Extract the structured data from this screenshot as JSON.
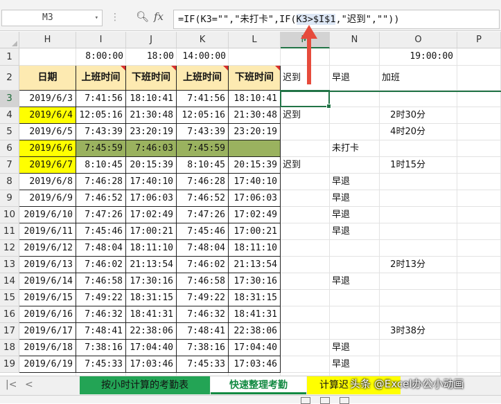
{
  "formula_bar": {
    "name_box": "M3",
    "name_box_dropdown": "▾",
    "separator": "⋮",
    "fx_label": "fx",
    "formula_prefix": "=IF(K3=\"\",\"未打卡\",IF(",
    "formula_highlight": "K3>$I$1",
    "formula_suffix": ",\"迟到\",\"\"))"
  },
  "columns": [
    "H",
    "I",
    "J",
    "K",
    "L",
    "M",
    "N",
    "O",
    "P"
  ],
  "selected_column": "M",
  "selected_row": "3",
  "row_numbers": [
    "1",
    "2",
    "3",
    "4",
    "5",
    "6",
    "7",
    "8",
    "9",
    "10",
    "11",
    "12",
    "13",
    "14",
    "15",
    "16",
    "17",
    "18",
    "19"
  ],
  "row1": {
    "I": "8:00:00",
    "J": "18:00",
    "K": "14:00:00",
    "O": "19:00:00"
  },
  "headers": {
    "H": "日期",
    "I": "上班时间",
    "J": "下班时间",
    "K": "上班时间",
    "L": "下班时间",
    "M": "迟到",
    "N": "早退",
    "O": "加班"
  },
  "rows": [
    {
      "date": "2019/6/3",
      "i": "7:41:56",
      "j": "18:10:41",
      "k": "7:41:56",
      "l": "18:10:41",
      "m": "",
      "n": "",
      "o": ""
    },
    {
      "date": "2019/6/4",
      "i": "12:05:16",
      "j": "21:30:48",
      "k": "12:05:16",
      "l": "21:30:48",
      "m": "迟到",
      "n": "",
      "o": "2时30分"
    },
    {
      "date": "2019/6/5",
      "i": "7:43:39",
      "j": "23:20:19",
      "k": "7:43:39",
      "l": "23:20:19",
      "m": "",
      "n": "",
      "o": "4时20分"
    },
    {
      "date": "2019/6/6",
      "i": "7:45:59",
      "j": "7:46:03",
      "k": "7:45:59",
      "l": "",
      "m": "",
      "n": "未打卡",
      "o": ""
    },
    {
      "date": "2019/6/7",
      "i": "8:10:45",
      "j": "20:15:39",
      "k": "8:10:45",
      "l": "20:15:39",
      "m": "迟到",
      "n": "",
      "o": "1时15分"
    },
    {
      "date": "2019/6/8",
      "i": "7:46:28",
      "j": "17:40:10",
      "k": "7:46:28",
      "l": "17:40:10",
      "m": "",
      "n": "早退",
      "o": ""
    },
    {
      "date": "2019/6/9",
      "i": "7:46:52",
      "j": "17:06:03",
      "k": "7:46:52",
      "l": "17:06:03",
      "m": "",
      "n": "早退",
      "o": ""
    },
    {
      "date": "2019/6/10",
      "i": "7:47:26",
      "j": "17:02:49",
      "k": "7:47:26",
      "l": "17:02:49",
      "m": "",
      "n": "早退",
      "o": ""
    },
    {
      "date": "2019/6/11",
      "i": "7:45:46",
      "j": "17:00:21",
      "k": "7:45:46",
      "l": "17:00:21",
      "m": "",
      "n": "早退",
      "o": ""
    },
    {
      "date": "2019/6/12",
      "i": "7:48:04",
      "j": "18:11:10",
      "k": "7:48:04",
      "l": "18:11:10",
      "m": "",
      "n": "",
      "o": ""
    },
    {
      "date": "2019/6/13",
      "i": "7:46:02",
      "j": "21:13:54",
      "k": "7:46:02",
      "l": "21:13:54",
      "m": "",
      "n": "",
      "o": "2时13分"
    },
    {
      "date": "2019/6/14",
      "i": "7:46:58",
      "j": "17:30:16",
      "k": "7:46:58",
      "l": "17:30:16",
      "m": "",
      "n": "早退",
      "o": ""
    },
    {
      "date": "2019/6/15",
      "i": "7:49:22",
      "j": "18:31:15",
      "k": "7:49:22",
      "l": "18:31:15",
      "m": "",
      "n": "",
      "o": ""
    },
    {
      "date": "2019/6/16",
      "i": "7:46:32",
      "j": "18:41:31",
      "k": "7:46:32",
      "l": "18:41:31",
      "m": "",
      "n": "",
      "o": ""
    },
    {
      "date": "2019/6/17",
      "i": "7:48:41",
      "j": "22:38:06",
      "k": "7:48:41",
      "l": "22:38:06",
      "m": "",
      "n": "",
      "o": "3时38分"
    },
    {
      "date": "2019/6/18",
      "i": "7:38:16",
      "j": "17:04:40",
      "k": "7:38:16",
      "l": "17:04:40",
      "m": "",
      "n": "早退",
      "o": ""
    },
    {
      "date": "2019/6/19",
      "i": "7:45:33",
      "j": "17:03:46",
      "k": "7:45:33",
      "l": "17:03:46",
      "m": "",
      "n": "早退",
      "o": ""
    }
  ],
  "row_fills": {
    "yellow_date_rows": [
      1,
      3,
      4
    ],
    "green_rows": [
      3
    ],
    "yellow": "#ffff00",
    "green": "#9ab25f",
    "header_fill": "#fdeab1",
    "comment_marker": "#d9302c"
  },
  "sheet_tabs": {
    "prev_first": "|<",
    "prev": "<",
    "tabs": [
      "按小时计算的考勤表",
      "快速整理考勤",
      "计算迟"
    ],
    "active_tab": "快速整理考勤"
  },
  "watermark": "头条 @Excel办公小动画",
  "colors": {
    "accent": "#217346",
    "arrow": "#e64b3c",
    "tab_green": "#23a455"
  }
}
